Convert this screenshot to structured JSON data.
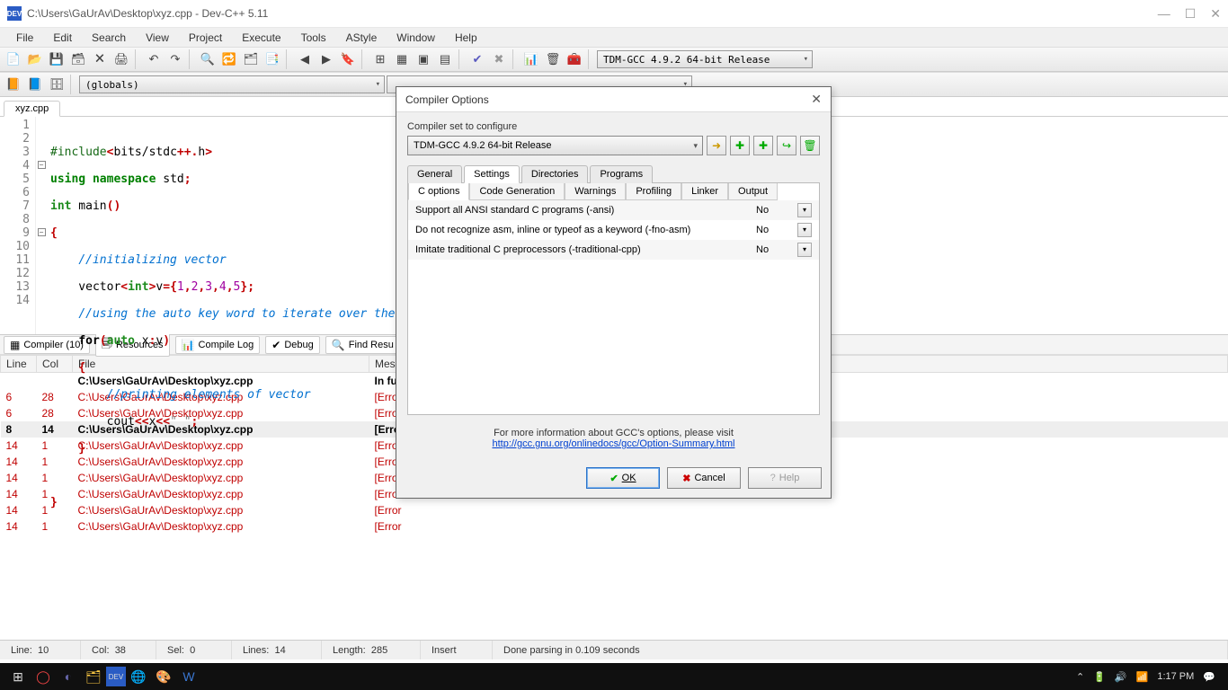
{
  "window": {
    "title": "C:\\Users\\GaUrAv\\Desktop\\xyz.cpp - Dev-C++ 5.11",
    "app_icon": "DEV"
  },
  "menu": [
    "File",
    "Edit",
    "Search",
    "View",
    "Project",
    "Execute",
    "Tools",
    "AStyle",
    "Window",
    "Help"
  ],
  "compiler_combo": "TDM-GCC 4.9.2 64-bit Release",
  "scope_combo": "(globals)",
  "filetab": "xyz.cpp",
  "code_lines": 14,
  "bottom_tabs": [
    {
      "icon": "▦",
      "label": "Compiler (10)"
    },
    {
      "icon": "🗐",
      "label": "Resources"
    },
    {
      "icon": "📊",
      "label": "Compile Log"
    },
    {
      "icon": "✔",
      "label": "Debug"
    },
    {
      "icon": "🔍",
      "label": "Find Resu"
    }
  ],
  "err_headers": [
    "Line",
    "Col",
    "File",
    "Messa"
  ],
  "err_rows": [
    {
      "line": "",
      "col": "",
      "file": "C:\\Users\\GaUrAv\\Desktop\\xyz.cpp",
      "msg": "In fun",
      "cls": "bold"
    },
    {
      "line": "6",
      "col": "28",
      "file": "C:\\Users\\GaUrAv\\Desktop\\xyz.cpp",
      "msg": "[Error",
      "cls": "err"
    },
    {
      "line": "6",
      "col": "28",
      "file": "C:\\Users\\GaUrAv\\Desktop\\xyz.cpp",
      "msg": "[Error",
      "cls": "err"
    },
    {
      "line": "8",
      "col": "14",
      "file": "C:\\Users\\GaUrAv\\Desktop\\xyz.cpp",
      "msg": "[Error",
      "cls": "bold",
      "sel": true
    },
    {
      "line": "14",
      "col": "1",
      "file": "C:\\Users\\GaUrAv\\Desktop\\xyz.cpp",
      "msg": "[Error",
      "cls": "err"
    },
    {
      "line": "14",
      "col": "1",
      "file": "C:\\Users\\GaUrAv\\Desktop\\xyz.cpp",
      "msg": "[Error",
      "cls": "err"
    },
    {
      "line": "14",
      "col": "1",
      "file": "C:\\Users\\GaUrAv\\Desktop\\xyz.cpp",
      "msg": "[Error",
      "cls": "err"
    },
    {
      "line": "14",
      "col": "1",
      "file": "C:\\Users\\GaUrAv\\Desktop\\xyz.cpp",
      "msg": "[Error",
      "cls": "err"
    },
    {
      "line": "14",
      "col": "1",
      "file": "C:\\Users\\GaUrAv\\Desktop\\xyz.cpp",
      "msg": "[Error",
      "cls": "err"
    },
    {
      "line": "14",
      "col": "1",
      "file": "C:\\Users\\GaUrAv\\Desktop\\xyz.cpp",
      "msg": "[Error",
      "cls": "err"
    }
  ],
  "status": {
    "line_lbl": "Line:",
    "line": "10",
    "col_lbl": "Col:",
    "col": "38",
    "sel_lbl": "Sel:",
    "sel": "0",
    "lines_lbl": "Lines:",
    "lines": "14",
    "length_lbl": "Length:",
    "length": "285",
    "mode": "Insert",
    "parse": "Done parsing in 0.109 seconds"
  },
  "taskbar": {
    "time": "1:17 PM"
  },
  "dialog": {
    "title": "Compiler Options",
    "set_label": "Compiler set to configure",
    "set_value": "TDM-GCC 4.9.2 64-bit Release",
    "tabs": [
      "General",
      "Settings",
      "Directories",
      "Programs"
    ],
    "subtabs": [
      "C options",
      "Code Generation",
      "Warnings",
      "Profiling",
      "Linker",
      "Output"
    ],
    "options": [
      {
        "label": "Support all ANSI standard C programs (-ansi)",
        "value": "No"
      },
      {
        "label": "Do not recognize asm, inline or typeof as a keyword (-fno-asm)",
        "value": "No"
      },
      {
        "label": "Imitate traditional C preprocessors (-traditional-cpp)",
        "value": "No"
      }
    ],
    "info_text": "For more information about GCC's options, please visit",
    "info_link": "http://gcc.gnu.org/onlinedocs/gcc/Option-Summary.html",
    "ok": "OK",
    "cancel": "Cancel",
    "help": "Help"
  }
}
